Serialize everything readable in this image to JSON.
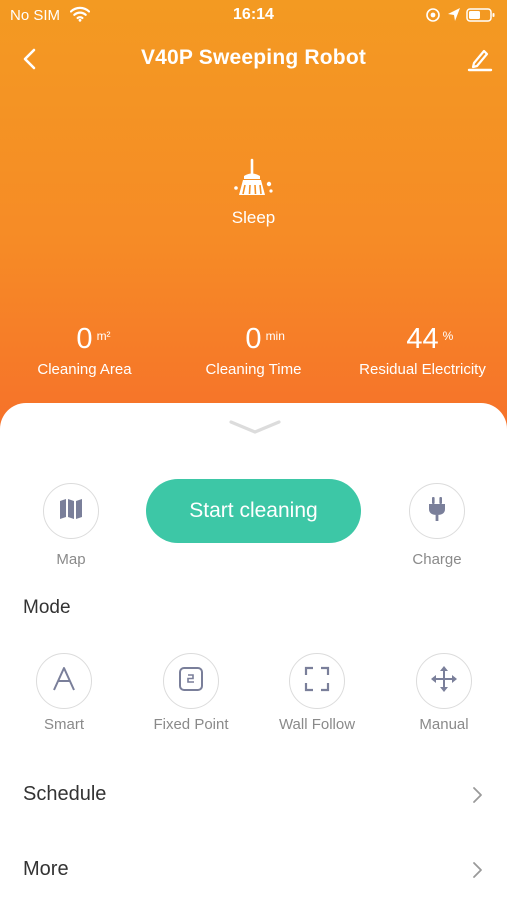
{
  "status_bar": {
    "carrier": "No SIM",
    "time": "16:14"
  },
  "nav": {
    "title": "V40P Sweeping Robot"
  },
  "device": {
    "status": "Sleep"
  },
  "stats": [
    {
      "value": "0",
      "unit": "m²",
      "label": "Cleaning Area"
    },
    {
      "value": "0",
      "unit": "min",
      "label": "Cleaning Time"
    },
    {
      "value": "44",
      "unit": "%",
      "label": "Residual Electricity"
    }
  ],
  "controls": {
    "map_label": "Map",
    "start_label": "Start cleaning",
    "charge_label": "Charge"
  },
  "mode": {
    "title": "Mode",
    "items": [
      {
        "label": "Smart"
      },
      {
        "label": "Fixed Point"
      },
      {
        "label": "Wall Follow"
      },
      {
        "label": "Manual"
      }
    ]
  },
  "rows": {
    "schedule": "Schedule",
    "more": "More"
  },
  "colors": {
    "accent_orange": "#F68B26",
    "start_button": "#3DC7A6"
  }
}
